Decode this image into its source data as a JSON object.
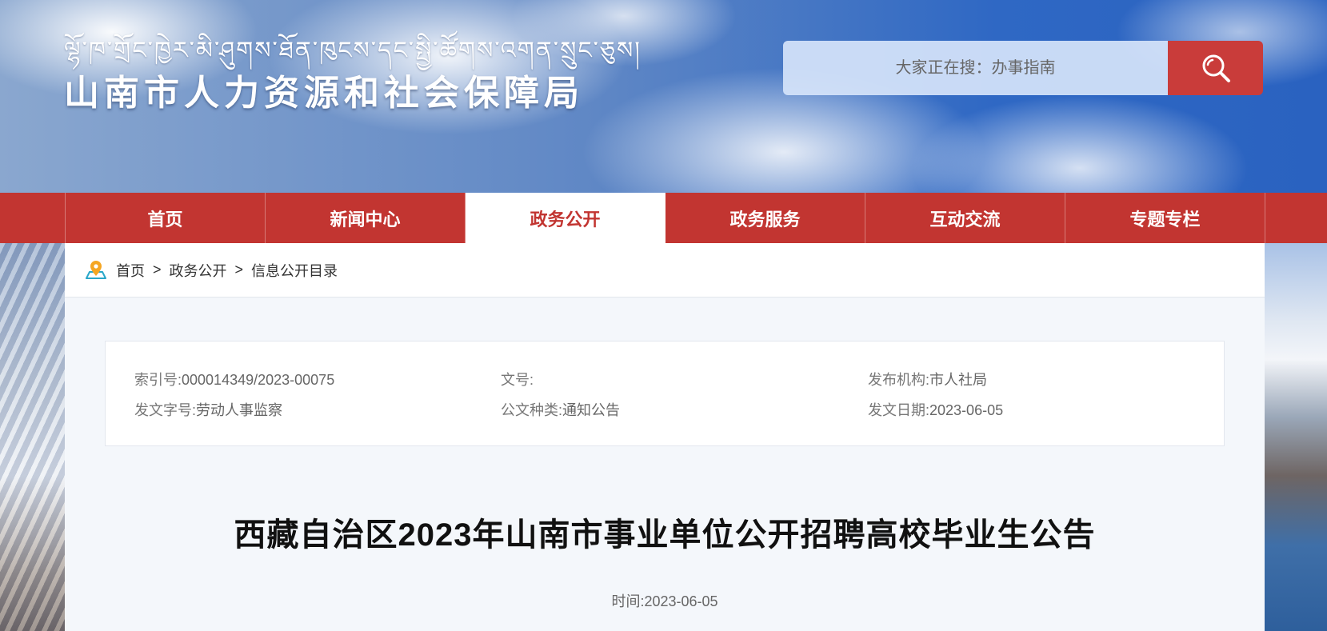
{
  "header": {
    "tibetan_title": "ལྷོ་ཁ་གྲོང་ཁྱེར་མི་ཤུགས་ཐོན་ཁུངས་དང་སྤྱི་ཚོགས་འགན་སྲུང་ཅུས།",
    "site_title": "山南市人力资源和社会保障局",
    "search": {
      "placeholder": "大家正在搜：办事指南"
    }
  },
  "nav": {
    "items": [
      {
        "label": "首页",
        "active": false
      },
      {
        "label": "新闻中心",
        "active": false
      },
      {
        "label": "政务公开",
        "active": true
      },
      {
        "label": "政务服务",
        "active": false
      },
      {
        "label": "互动交流",
        "active": false
      },
      {
        "label": "专题专栏",
        "active": false
      }
    ]
  },
  "breadcrumb": {
    "items": [
      "首页",
      "政务公开",
      "信息公开目录"
    ],
    "separator": ">"
  },
  "meta": {
    "index_no": {
      "label": "索引号:",
      "value": "000014349/2023-00075"
    },
    "doc_no": {
      "label": "文号:",
      "value": ""
    },
    "publisher": {
      "label": "发布机构:",
      "value": "市人社局"
    },
    "issuer_code": {
      "label": "发文字号:",
      "value": "劳动人事监察"
    },
    "doc_type": {
      "label": "公文种类:",
      "value": "通知公告"
    },
    "issue_date": {
      "label": "发文日期:",
      "value": "2023-06-05"
    }
  },
  "article": {
    "title": "西藏自治区2023年山南市事业单位公开招聘高校毕业生公告",
    "time_label": "时间:",
    "time_value": "2023-06-05"
  },
  "colors": {
    "brand_red": "#c23531",
    "search_button": "#c93c3a",
    "panel_bg": "#f4f7fb"
  },
  "icons": {
    "search": "search-icon",
    "location": "location-pin-icon"
  }
}
